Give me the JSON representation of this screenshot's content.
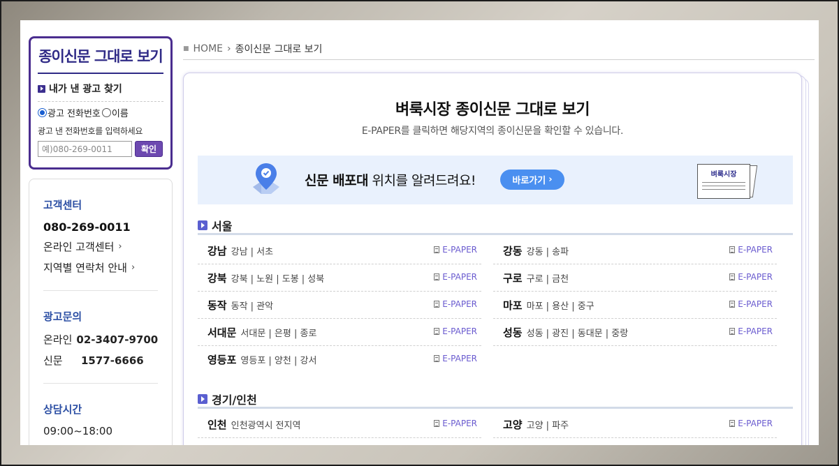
{
  "sidebar": {
    "search_title": "종이신문 그대로 보기",
    "find_ad_label": "내가 낸 광고 찾기",
    "radio_phone": "광고 전화번호",
    "radio_name": "이름",
    "hint": "광고 낸 전화번호를 입력하세요",
    "phone_placeholder": "예)080-269-0011",
    "confirm_label": "확인",
    "customer_center": {
      "heading": "고객센터",
      "phone": "080-269-0011",
      "online_link": "온라인 고객센터",
      "regional_link": "지역별 연락처 안내"
    },
    "ad_inquiry": {
      "heading": "광고문의",
      "online_label": "온라인",
      "online_phone": "02-3407-9700",
      "paper_label": "신문",
      "paper_phone": "1577-6666"
    },
    "hours": {
      "heading": "상담시간",
      "time": "09:00~18:00"
    }
  },
  "breadcrumb": {
    "home": "HOME",
    "current": "종이신문 그대로 보기"
  },
  "main": {
    "title": "벼룩시장 종이신문 그대로 보기",
    "subtitle": "E-PAPER를 클릭하면 해당지역의 종이신문을 확인할 수 있습니다.",
    "banner": {
      "text_bold": "신문 배포대",
      "text_rest": " 위치를 알려드려요!",
      "button": "바로가기",
      "card_title": "벼룩시장"
    },
    "epaper_label": "E-PAPER",
    "regions": [
      {
        "name": "서울",
        "rows": [
          {
            "name": "강남",
            "areas": "강남 | 서초"
          },
          {
            "name": "강동",
            "areas": "강동 | 송파"
          },
          {
            "name": "강북",
            "areas": "강북 | 노원 | 도봉 | 성북"
          },
          {
            "name": "구로",
            "areas": "구로 | 금천"
          },
          {
            "name": "동작",
            "areas": "동작 | 관악"
          },
          {
            "name": "마포",
            "areas": "마포 | 용산 | 중구"
          },
          {
            "name": "서대문",
            "areas": "서대문 | 은평 | 종로"
          },
          {
            "name": "성동",
            "areas": "성동 | 광진 | 동대문 | 중랑"
          },
          {
            "name": "영등포",
            "areas": "영등포 | 양천 | 강서"
          }
        ]
      },
      {
        "name": "경기/인천",
        "rows": [
          {
            "name": "인천",
            "areas": "인천광역시 전지역"
          },
          {
            "name": "고양",
            "areas": "고양 | 파주"
          }
        ]
      }
    ]
  },
  "colors": {
    "brand_purple": "#4a2d8f",
    "link_blue": "#2b4ea3",
    "button_blue": "#4a8ff0",
    "banner_bg": "#e9f1fd",
    "epaper_text": "#6a5bcf"
  }
}
